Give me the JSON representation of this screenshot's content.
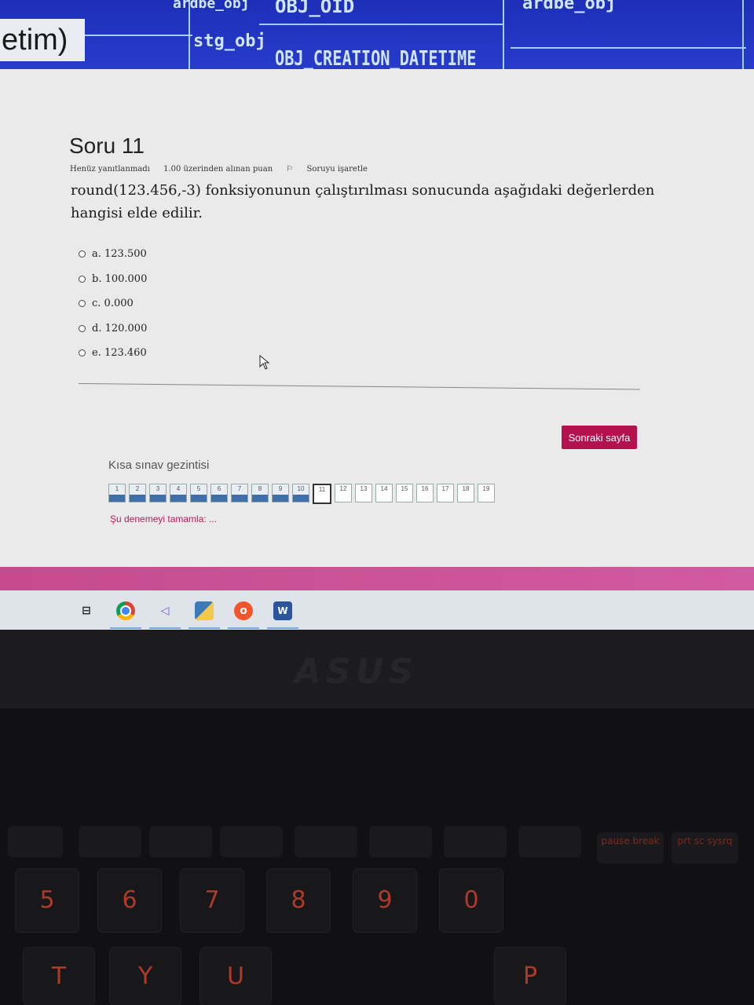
{
  "background": {
    "window_fragment": "etim)",
    "diagram_labels": [
      "ardbe_obj",
      "OBJ_OID",
      "stg_obj",
      "OBJ_CREATION_DATETIME",
      "ardbe_obj"
    ]
  },
  "question": {
    "title": "Soru 11",
    "status": "Henüz yanıtlanmadı",
    "points": "1.00 üzerinden alınan puan",
    "flag": "Soruyu işaretle",
    "text": "round(123.456,-3) fonksiyonunun çalıştırılması sonucunda aşağıdaki değerlerden hangisi elde edilir.",
    "options": [
      {
        "label": "a. 123.500"
      },
      {
        "label": "b. 100.000"
      },
      {
        "label": "c. 0.000"
      },
      {
        "label": "d. 120.000"
      },
      {
        "label": "e. 123.460"
      }
    ]
  },
  "next_button": "Sonraki sayfa",
  "quiz_nav": {
    "title": "Kısa sınav gezintisi",
    "items": [
      {
        "n": "1",
        "state": "answered"
      },
      {
        "n": "2",
        "state": "answered"
      },
      {
        "n": "3",
        "state": "answered"
      },
      {
        "n": "4",
        "state": "answered"
      },
      {
        "n": "5",
        "state": "answered"
      },
      {
        "n": "6",
        "state": "answered"
      },
      {
        "n": "7",
        "state": "answered"
      },
      {
        "n": "8",
        "state": "answered"
      },
      {
        "n": "9",
        "state": "answered"
      },
      {
        "n": "10",
        "state": "answered"
      },
      {
        "n": "11",
        "state": "current"
      },
      {
        "n": "12",
        "state": "empty"
      },
      {
        "n": "13",
        "state": "empty"
      },
      {
        "n": "14",
        "state": "empty"
      },
      {
        "n": "15",
        "state": "empty"
      },
      {
        "n": "16",
        "state": "empty"
      },
      {
        "n": "17",
        "state": "empty"
      },
      {
        "n": "18",
        "state": "empty"
      },
      {
        "n": "19",
        "state": "empty"
      }
    ],
    "finish_link": "Şu denemeyi tamamla: ..."
  },
  "taskbar": {
    "icons": [
      "task-view-icon",
      "chrome-icon",
      "visual-studio-icon",
      "python-icon",
      "opera-icon",
      "word-icon"
    ],
    "word_text": "W"
  },
  "laptop": {
    "brand": "ASUS",
    "keys": [
      "5",
      "6",
      "7",
      "8",
      "9",
      "0",
      "T",
      "Y",
      "U",
      "P"
    ],
    "fkeys": [
      "pause break",
      "prt sc sysrq"
    ]
  }
}
